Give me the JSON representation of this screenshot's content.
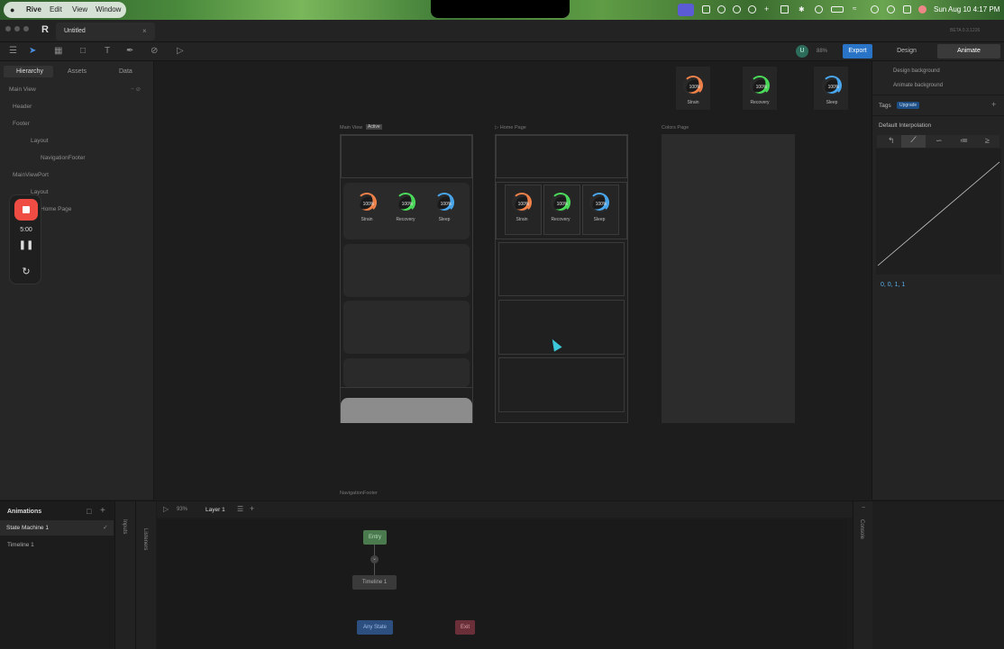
{
  "menubar": {
    "app": "Rive",
    "items": [
      "Edit",
      "View",
      "Window"
    ],
    "datetime": "Sun Aug 10  4:17 PM"
  },
  "titlebar": {
    "doc_title": "Untitled",
    "version": "BETA 0.3.1226"
  },
  "toolbar": {
    "avatar_letter": "U",
    "zoom": "88%",
    "export_label": "Export",
    "design_tab": "Design",
    "animate_tab": "Animate"
  },
  "left_panel": {
    "tabs": [
      "Hierarchy",
      "Assets",
      "Data"
    ],
    "tree": [
      "Main View",
      "Header",
      "Footer",
      "Layout",
      "NavigationFooter",
      "MainViewPort",
      "Layout",
      "Home Page"
    ]
  },
  "floating": {
    "timer": "5:00"
  },
  "canvas": {
    "frames": {
      "main": "Main View",
      "main_badge": "Active",
      "home": "Home Page",
      "colors": "Colors Page",
      "footer": "NavigationFooter"
    },
    "rings": [
      {
        "pct": "100%",
        "label": "Strain",
        "color": "#f0824a"
      },
      {
        "pct": "100%",
        "label": "Recovery",
        "color": "#4bdc5a"
      },
      {
        "pct": "100%",
        "label": "Sleep",
        "color": "#4aa8f0"
      }
    ]
  },
  "right_panel": {
    "bg_options": [
      "Design background",
      "Animate background"
    ],
    "tags": "Tags",
    "upgrade": "Upgrade",
    "interp_title": "Default Interpolation",
    "curve_values": "0, 0, 1, 1"
  },
  "bottom": {
    "animations_title": "Animations",
    "items": [
      "State Machine 1",
      "Timeline 1"
    ],
    "side_labels": [
      "Inputs",
      "Listeners",
      "Console"
    ],
    "sm_zoom": "93%",
    "layer": "Layer 1",
    "nodes": {
      "entry": "Entry",
      "timeline": "Timeline 1",
      "any": "Any State",
      "exit": "Exit"
    }
  }
}
